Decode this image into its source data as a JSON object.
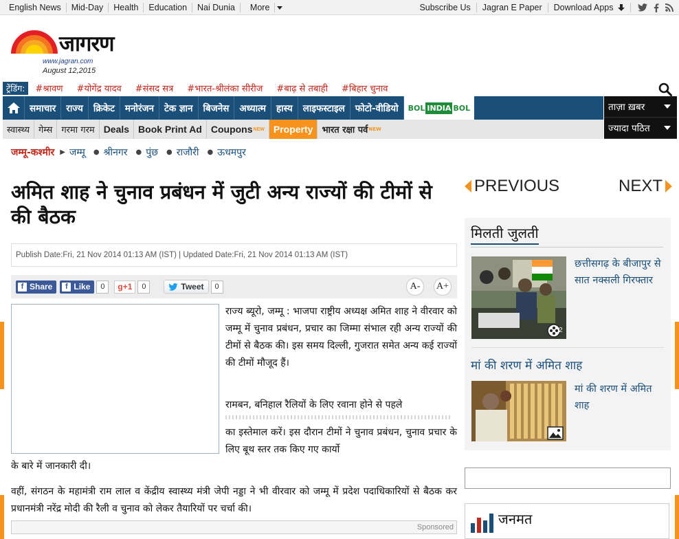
{
  "topbar": {
    "left_links": [
      "English News",
      "Mid-Day",
      "Health",
      "Education",
      "Nai Dunia",
      "More"
    ],
    "right_links": [
      "Subscribe Us",
      "Jagran E Paper",
      "Download Apps"
    ]
  },
  "logo": {
    "name": "जागरण",
    "url": "www.jagran.com",
    "date": "August 12,2015"
  },
  "trending": {
    "label": "ट्रेंडिंग:",
    "tags": [
      "#श्रावण",
      "#योगेंद्र यादव",
      "#संसद सत्र",
      "#भारत-श्रीलंका सीरीज",
      "#बाढ़ से तबाही",
      "#बिहार चुनाव"
    ]
  },
  "main_nav": {
    "items": [
      "समाचार",
      "राज्य",
      "क्रिकेट",
      "मनोरंजन",
      "टेक ज्ञान",
      "बिजनेस",
      "अध्यात्म",
      "हास्य",
      "लाइफस्टाइल",
      "फोटो-वीडियो"
    ],
    "bolindia": [
      "BOL",
      "INDIA",
      "BOL"
    ],
    "right": [
      "ताज़ा ख़बर",
      "ज्यादा पठित"
    ]
  },
  "sub_nav": {
    "items": [
      "स्वास्थ्य",
      "गेम्स",
      "गरमा गरम",
      "Deals",
      "Book Print Ad",
      "Coupons",
      "Property",
      "भारत रक्षा पर्व"
    ],
    "new_badge": "NEW"
  },
  "breadcrumb": {
    "state": "जम्मू-कश्मीर",
    "cities": [
      "जम्मू",
      "श्रीनगर",
      "पुंछ",
      "राजौरी",
      "ऊधमपुर"
    ]
  },
  "article": {
    "headline": "अमित शाह ने चुनाव प्रबंधन में जुटी अन्य राज्यों की टीमों से की बैठक",
    "dates": "Publish Date:Fri, 21 Nov 2014 01:13 AM (IST) | Updated Date:Fri, 21 Nov 2014 01:13 AM (IST)",
    "share": {
      "share_label": "Share",
      "like_label": "Like",
      "like_count": "0",
      "gplus_label": "g+1",
      "gplus_count": "0",
      "tweet_label": "Tweet",
      "tweet_count": "0",
      "font_down": "A-",
      "font_up": "A+"
    },
    "p1": "राज्य ब्यूरो, जम्मू : भाजपा राष्ट्रीय अध्यक्ष अमित शाह ने वीरवार को जम्मू में चुनाव प्रबंधन, प्रचार का जिम्मा संभाल रही अन्य राज्यों की टीमों से बैठक की। इस समय दिल्ली, गुजरात समेत अन्य कई राज्यों की टीमों मौजूद हैं।",
    "p2a": "रामबन, बनिहाल रैलियों के लिए रवाना होने से पहले",
    "p2b": "का इस्तेमाल करें। इस दौरान टीमों ने चुनाव प्रबंधन, चुनाव प्रचार के लिए बूथ स्तर तक किए गए कार्यो",
    "p2c": "के बारे में जानकारी दी।",
    "p3": "वहीं, संगठन के महामंत्री राम लाल व केंद्रीय स्वास्थ्य मंत्री जेपी नड्डा ने भी वीरवार को जम्मू में प्रदेश पदाधिकारियों से बैठक कर प्रधानमंत्री नरेंद्र मोदी की रैली व चुनाव को लेकर तैयारियों पर चर्चा की।",
    "sponsored": "Sponsored"
  },
  "sidebar": {
    "prev": "PREVIOUS",
    "next": "NEXT",
    "related_title": "मिलती जुलती",
    "item1_text": "छत्तीसगढ़ के बीजापुर से सात नक्सली गिरफ्तार",
    "item1_count": "2",
    "item2_head": "मां की शरण में अमित शाह",
    "item2_text": "मां की शरण में अमित शाह",
    "poll_title": "जनमत"
  }
}
